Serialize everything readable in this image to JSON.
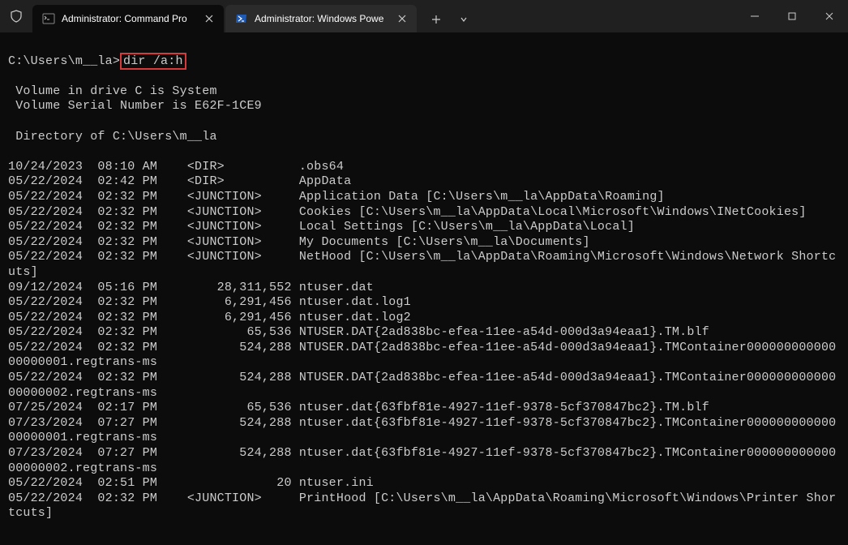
{
  "titlebar": {
    "tabs": [
      {
        "title": "Administrator: Command Pro",
        "icon": "cmd"
      },
      {
        "title": "Administrator: Windows Powe",
        "icon": "powershell"
      }
    ]
  },
  "terminal": {
    "prompt": "C:\\Users\\m__la>",
    "command": "dir /a:h",
    "lines": [
      " Volume in drive C is System",
      " Volume Serial Number is E62F-1CE9",
      "",
      " Directory of C:\\Users\\m__la",
      "",
      "10/24/2023  08:10 AM    <DIR>          .obs64",
      "05/22/2024  02:42 PM    <DIR>          AppData",
      "05/22/2024  02:32 PM    <JUNCTION>     Application Data [C:\\Users\\m__la\\AppData\\Roaming]",
      "05/22/2024  02:32 PM    <JUNCTION>     Cookies [C:\\Users\\m__la\\AppData\\Local\\Microsoft\\Windows\\INetCookies]",
      "05/22/2024  02:32 PM    <JUNCTION>     Local Settings [C:\\Users\\m__la\\AppData\\Local]",
      "05/22/2024  02:32 PM    <JUNCTION>     My Documents [C:\\Users\\m__la\\Documents]",
      "05/22/2024  02:32 PM    <JUNCTION>     NetHood [C:\\Users\\m__la\\AppData\\Roaming\\Microsoft\\Windows\\Network Shortcuts]",
      "09/12/2024  05:16 PM        28,311,552 ntuser.dat",
      "05/22/2024  02:32 PM         6,291,456 ntuser.dat.log1",
      "05/22/2024  02:32 PM         6,291,456 ntuser.dat.log2",
      "05/22/2024  02:32 PM            65,536 NTUSER.DAT{2ad838bc-efea-11ee-a54d-000d3a94eaa1}.TM.blf",
      "05/22/2024  02:32 PM           524,288 NTUSER.DAT{2ad838bc-efea-11ee-a54d-000d3a94eaa1}.TMContainer00000000000000000001.regtrans-ms",
      "05/22/2024  02:32 PM           524,288 NTUSER.DAT{2ad838bc-efea-11ee-a54d-000d3a94eaa1}.TMContainer00000000000000000002.regtrans-ms",
      "07/25/2024  02:17 PM            65,536 ntuser.dat{63fbf81e-4927-11ef-9378-5cf370847bc2}.TM.blf",
      "07/23/2024  07:27 PM           524,288 ntuser.dat{63fbf81e-4927-11ef-9378-5cf370847bc2}.TMContainer00000000000000000001.regtrans-ms",
      "07/23/2024  07:27 PM           524,288 ntuser.dat{63fbf81e-4927-11ef-9378-5cf370847bc2}.TMContainer00000000000000000002.regtrans-ms",
      "05/22/2024  02:51 PM                20 ntuser.ini",
      "05/22/2024  02:32 PM    <JUNCTION>     PrintHood [C:\\Users\\m__la\\AppData\\Roaming\\Microsoft\\Windows\\Printer Shortcuts]"
    ]
  }
}
